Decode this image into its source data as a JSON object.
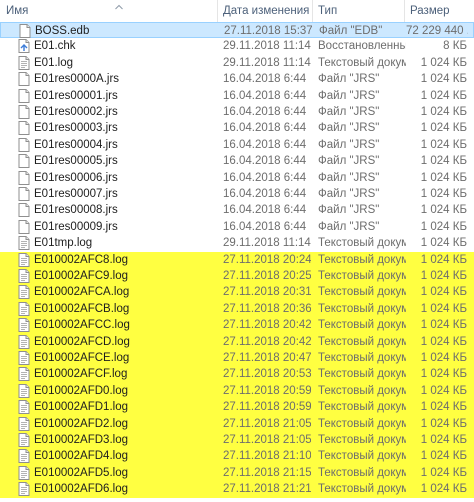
{
  "columns": {
    "name": "Имя",
    "date": "Дата изменения",
    "type": "Тип",
    "size": "Размер"
  },
  "colors": {
    "selected_bg": "#cce8ff",
    "highlight_bg": "#ffff41",
    "header_text": "#4c607a"
  },
  "files": [
    {
      "name": "BOSS.edb",
      "date": "27.11.2018 15:37",
      "type": "Файл \"EDB\"",
      "size": "72 229 440 ...",
      "icon": "blank-file-icon",
      "state": "selected"
    },
    {
      "name": "E01.chk",
      "date": "29.11.2018 11:14",
      "type": "Восстановленны...",
      "size": "8 КБ",
      "icon": "recovered-file-icon",
      "state": "normal"
    },
    {
      "name": "E01.log",
      "date": "29.11.2018 11:14",
      "type": "Текстовый докум...",
      "size": "1 024 КБ",
      "icon": "text-document-icon",
      "state": "normal"
    },
    {
      "name": "E01res0000A.jrs",
      "date": "16.04.2018 6:44",
      "type": "Файл \"JRS\"",
      "size": "1 024 КБ",
      "icon": "blank-file-icon",
      "state": "normal"
    },
    {
      "name": "E01res00001.jrs",
      "date": "16.04.2018 6:44",
      "type": "Файл \"JRS\"",
      "size": "1 024 КБ",
      "icon": "blank-file-icon",
      "state": "normal"
    },
    {
      "name": "E01res00002.jrs",
      "date": "16.04.2018 6:44",
      "type": "Файл \"JRS\"",
      "size": "1 024 КБ",
      "icon": "blank-file-icon",
      "state": "normal"
    },
    {
      "name": "E01res00003.jrs",
      "date": "16.04.2018 6:44",
      "type": "Файл \"JRS\"",
      "size": "1 024 КБ",
      "icon": "blank-file-icon",
      "state": "normal"
    },
    {
      "name": "E01res00004.jrs",
      "date": "16.04.2018 6:44",
      "type": "Файл \"JRS\"",
      "size": "1 024 КБ",
      "icon": "blank-file-icon",
      "state": "normal"
    },
    {
      "name": "E01res00005.jrs",
      "date": "16.04.2018 6:44",
      "type": "Файл \"JRS\"",
      "size": "1 024 КБ",
      "icon": "blank-file-icon",
      "state": "normal"
    },
    {
      "name": "E01res00006.jrs",
      "date": "16.04.2018 6:44",
      "type": "Файл \"JRS\"",
      "size": "1 024 КБ",
      "icon": "blank-file-icon",
      "state": "normal"
    },
    {
      "name": "E01res00007.jrs",
      "date": "16.04.2018 6:44",
      "type": "Файл \"JRS\"",
      "size": "1 024 КБ",
      "icon": "blank-file-icon",
      "state": "normal"
    },
    {
      "name": "E01res00008.jrs",
      "date": "16.04.2018 6:44",
      "type": "Файл \"JRS\"",
      "size": "1 024 КБ",
      "icon": "blank-file-icon",
      "state": "normal"
    },
    {
      "name": "E01res00009.jrs",
      "date": "16.04.2018 6:44",
      "type": "Файл \"JRS\"",
      "size": "1 024 КБ",
      "icon": "blank-file-icon",
      "state": "normal"
    },
    {
      "name": "E01tmp.log",
      "date": "29.11.2018 11:14",
      "type": "Текстовый докум...",
      "size": "1 024 КБ",
      "icon": "text-document-icon",
      "state": "normal"
    },
    {
      "name": "E010002AFC8.log",
      "date": "27.11.2018 20:24",
      "type": "Текстовый докум...",
      "size": "1 024 КБ",
      "icon": "text-document-icon",
      "state": "highlight"
    },
    {
      "name": "E010002AFC9.log",
      "date": "27.11.2018 20:25",
      "type": "Текстовый докум...",
      "size": "1 024 КБ",
      "icon": "text-document-icon",
      "state": "highlight"
    },
    {
      "name": "E010002AFCA.log",
      "date": "27.11.2018 20:31",
      "type": "Текстовый докум...",
      "size": "1 024 КБ",
      "icon": "text-document-icon",
      "state": "highlight"
    },
    {
      "name": "E010002AFCB.log",
      "date": "27.11.2018 20:36",
      "type": "Текстовый докум...",
      "size": "1 024 КБ",
      "icon": "text-document-icon",
      "state": "highlight"
    },
    {
      "name": "E010002AFCC.log",
      "date": "27.11.2018 20:42",
      "type": "Текстовый докум...",
      "size": "1 024 КБ",
      "icon": "text-document-icon",
      "state": "highlight"
    },
    {
      "name": "E010002AFCD.log",
      "date": "27.11.2018 20:42",
      "type": "Текстовый докум...",
      "size": "1 024 КБ",
      "icon": "text-document-icon",
      "state": "highlight"
    },
    {
      "name": "E010002AFCE.log",
      "date": "27.11.2018 20:47",
      "type": "Текстовый докум...",
      "size": "1 024 КБ",
      "icon": "text-document-icon",
      "state": "highlight"
    },
    {
      "name": "E010002AFCF.log",
      "date": "27.11.2018 20:53",
      "type": "Текстовый докум...",
      "size": "1 024 КБ",
      "icon": "text-document-icon",
      "state": "highlight"
    },
    {
      "name": "E010002AFD0.log",
      "date": "27.11.2018 20:59",
      "type": "Текстовый докум...",
      "size": "1 024 КБ",
      "icon": "text-document-icon",
      "state": "highlight"
    },
    {
      "name": "E010002AFD1.log",
      "date": "27.11.2018 20:59",
      "type": "Текстовый докум...",
      "size": "1 024 КБ",
      "icon": "text-document-icon",
      "state": "highlight"
    },
    {
      "name": "E010002AFD2.log",
      "date": "27.11.2018 21:05",
      "type": "Текстовый докум...",
      "size": "1 024 КБ",
      "icon": "text-document-icon",
      "state": "highlight"
    },
    {
      "name": "E010002AFD3.log",
      "date": "27.11.2018 21:05",
      "type": "Текстовый докум...",
      "size": "1 024 КБ",
      "icon": "text-document-icon",
      "state": "highlight"
    },
    {
      "name": "E010002AFD4.log",
      "date": "27.11.2018 21:10",
      "type": "Текстовый докум...",
      "size": "1 024 КБ",
      "icon": "text-document-icon",
      "state": "highlight"
    },
    {
      "name": "E010002AFD5.log",
      "date": "27.11.2018 21:15",
      "type": "Текстовый докум...",
      "size": "1 024 КБ",
      "icon": "text-document-icon",
      "state": "highlight"
    },
    {
      "name": "E010002AFD6.log",
      "date": "27.11.2018 21:21",
      "type": "Текстовый докум...",
      "size": "1 024 КБ",
      "icon": "text-document-icon",
      "state": "highlight"
    }
  ]
}
